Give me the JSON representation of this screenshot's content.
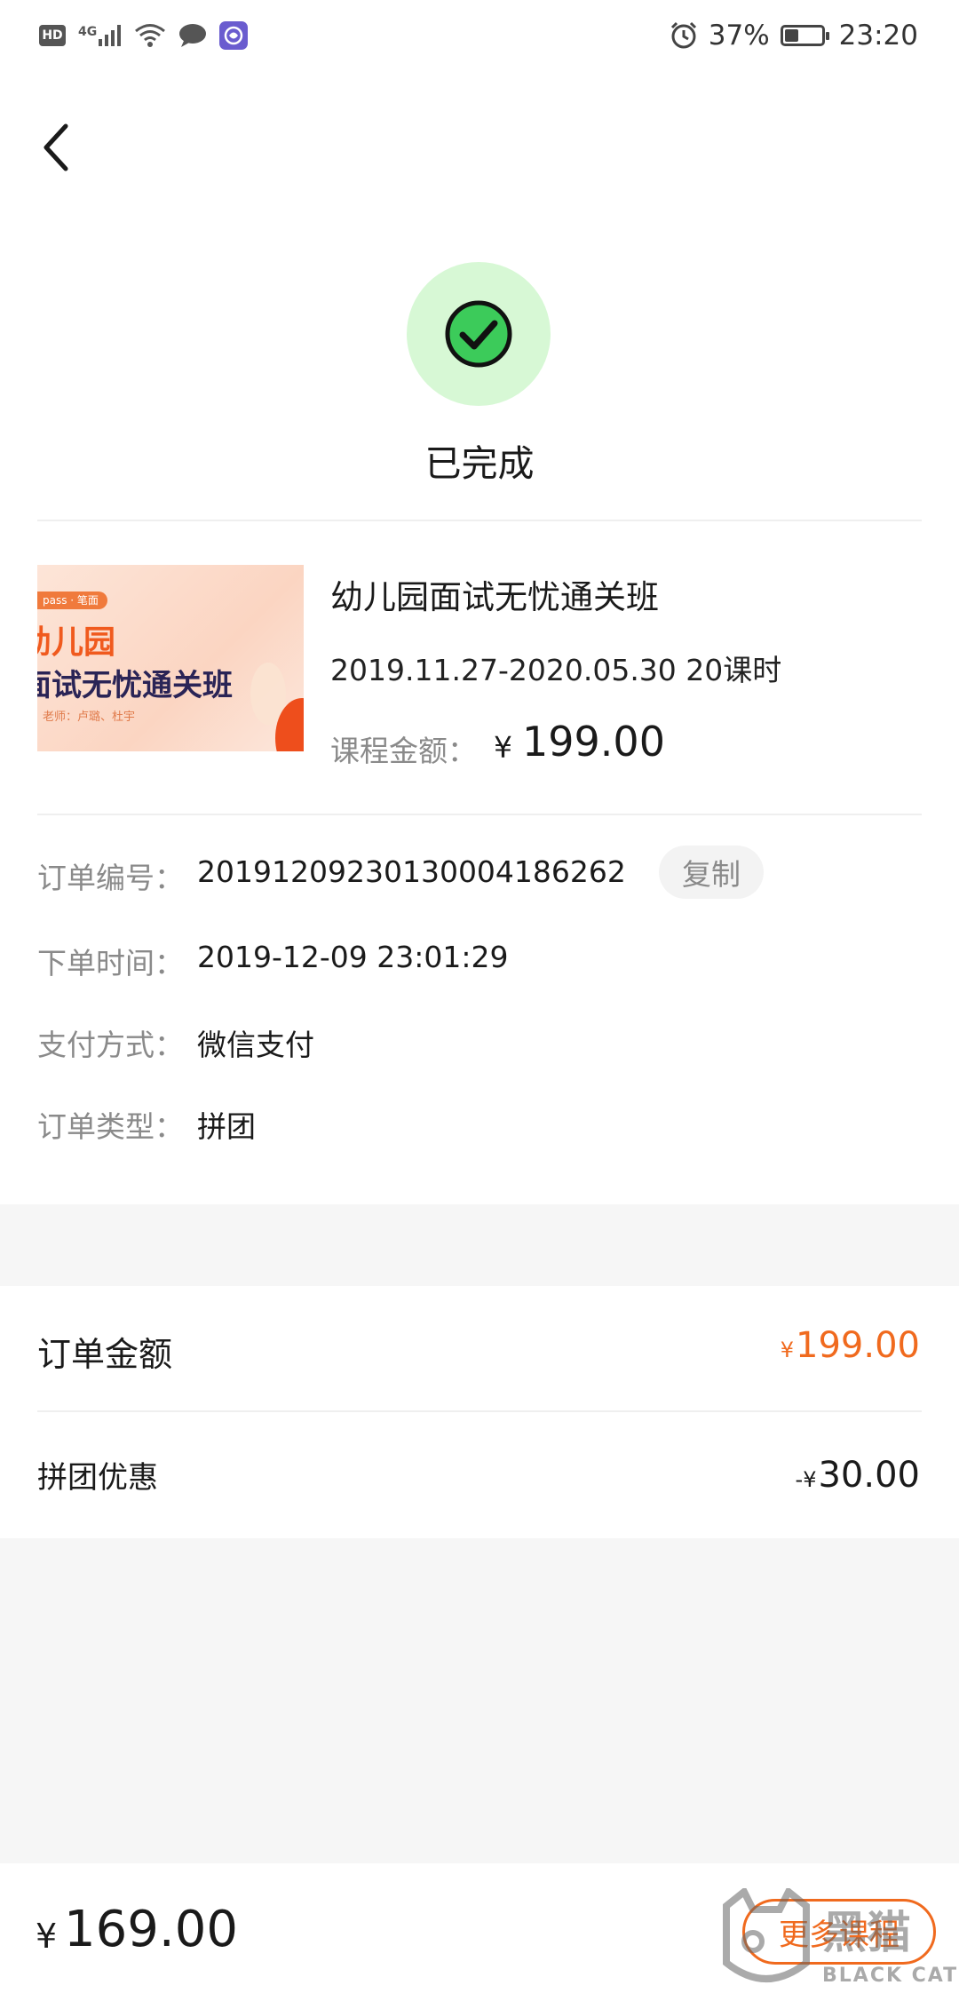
{
  "status_bar": {
    "left_badge": "HD",
    "network": "4G",
    "battery_percent": "37%",
    "battery_level": 0.37,
    "time": "23:20",
    "icons": [
      "hd-icon",
      "signal-icon",
      "wifi-icon",
      "message-icon",
      "app-notification-icon",
      "alarm-icon",
      "battery-icon"
    ]
  },
  "header": {
    "back_icon": "chevron-left-icon"
  },
  "order_status": {
    "icon": "check-circle-icon",
    "text": "已完成",
    "accent": "#d7f8d5"
  },
  "course": {
    "thumbnail": {
      "tag": "pass · 笔面",
      "line1": "幼儿园",
      "line2": "面试无忧通关班",
      "line3": "老师：卢璐、杜宇"
    },
    "title": "幼儿园面试无忧通关班",
    "period": "2019.11.27-2020.05.30 20课时",
    "price_label": "课程金额：",
    "price_currency": "¥",
    "price": "199.00"
  },
  "order_info": {
    "number_label": "订单编号：",
    "number": "20191209230130004186262",
    "copy_label": "复制",
    "time_label": "下单时间：",
    "time": "2019-12-09 23:01:29",
    "payment_label": "支付方式：",
    "payment": "微信支付",
    "type_label": "订单类型：",
    "type": "拼团"
  },
  "amounts": {
    "order_amount_label": "订单金额",
    "order_amount_currency": "¥",
    "order_amount": "199.00",
    "discount_label": "拼团优惠",
    "discount_prefix": "-¥",
    "discount": "30.00"
  },
  "bottom": {
    "total_currency": "¥",
    "total": "169.00",
    "more_button": "更多课程"
  },
  "watermark": {
    "text": "黑猫",
    "subtext": "BLACK CAT"
  },
  "colors": {
    "accent_orange": "#f06a1e",
    "success_green": "#d7f8d5",
    "muted": "#8a8a8a"
  }
}
